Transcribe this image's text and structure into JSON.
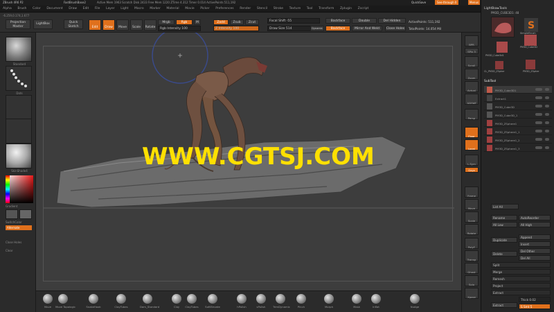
{
  "titlebar": {
    "app": "ZBrush 4R6 P2",
    "doc": "FastBrushBase2",
    "stats": "Active Mem 1963  Scratch Disk 2433  Free Mem 1220  ZTime 4.312  Timer 0.014  ActivePoints 511,192",
    "quicksave": "QuickSave",
    "see_through": "See-through  0",
    "menus": "Menus",
    "script": "DefaultZScript"
  },
  "menubar": {
    "items": [
      "Alpha",
      "Brush",
      "Color",
      "Document",
      "Draw",
      "Edit",
      "File",
      "Layer",
      "Light",
      "Macro",
      "Marker",
      "Material",
      "Movie",
      "Picker",
      "Preferences",
      "Render",
      "Stencil",
      "Stroke",
      "Texture",
      "Tool",
      "Transform",
      "Zplugin",
      "Zscript"
    ]
  },
  "coords": "-6.259,0.174,1.677",
  "topbar": {
    "projection_master": "Projection Master",
    "lightbox": "LightBox",
    "quick_sketch": "Quick Sketch",
    "edit": "Edit",
    "draw": "Draw",
    "move": "Move",
    "scale": "Scale",
    "rotate": "Rotate",
    "mrgb": "Mrgb",
    "rgb": "Rgb",
    "m": "M",
    "zadd": "Zadd",
    "zsub": "Zsub",
    "zcut": "Zcut",
    "rgb_intensity": "Rgb Intensity 100",
    "z_intensity": "Z Intensity 100",
    "z_intensity_value": 1.0,
    "focal_shift": "Focal Shift -55",
    "draw_size": "Draw Size 514",
    "dynamic": "Dynamic",
    "backface": "Backface",
    "double": "Double",
    "del_hidden": "Del Hidden",
    "close_holes": "Close Holes",
    "mirror_weld": "Mirror And Weld",
    "active_points": "ActivePoints: 511,192",
    "total_points": "TotalPoints: 14.054 Mil",
    "focal_shift_value": 0.22
  },
  "leftshelf": {
    "labels": [
      "Standard",
      "Dots",
      "Alpha Off",
      "Texture Off",
      "SkinShade4"
    ],
    "gradient": "Gradient",
    "switch_color": "SwitchColor",
    "alternate": "Alternate",
    "close_holes": "Close Holes",
    "clear": "Clear"
  },
  "rightshelf": {
    "buttons": [
      "BPR",
      "SPix 3",
      "Scroll",
      "Zoom",
      "Actual",
      "AAHalf",
      "Persp",
      "Floor",
      "Local",
      "L.Sym",
      "Gxyz",
      "Frame",
      "Move",
      "Scale",
      "Rotate",
      "PolyF",
      "Transp",
      "Ghost",
      "Solo",
      "Xpose"
    ]
  },
  "tray": {
    "header": "LightBox▸Tools",
    "tool_name": "PM3D_CUBE3D1: 48",
    "tools": [
      "PM3D_Cube3d1",
      "SimpleBrush",
      "PM3D_Cube3D",
      "CL_PM3D_ZSpher",
      "PM3D_ZSpher"
    ],
    "subtool_title": "SubTool",
    "subtools": [
      "PM3D_Cube3D1",
      "Extract1",
      "PM3D_Cube3D",
      "PM3D_Cube3D_1",
      "PM3D_ZSphere1",
      "PM3D_ZSphere1_1",
      "PM3D_ZSphere1_2",
      "PM3D_ZSphere1_3"
    ],
    "list_all": "List All",
    "rename": "Rename",
    "auto_reorder": "AutoReorder",
    "all_low": "All Low",
    "all_high": "All High",
    "duplicate": "Duplicate",
    "append": "Append",
    "insert": "Insert",
    "delete": "Delete",
    "del_other": "Del Other",
    "del_all": "Del All",
    "split": "Split",
    "merge": "Merge",
    "remesh": "Remesh",
    "project": "Project",
    "extract": "Extract",
    "thick": "Thick 0.02",
    "s_smt": "S Smt 5"
  },
  "bottom": {
    "brushes": [
      "Move",
      "Move Topologic",
      "SnakeHook",
      "ClayTubes",
      "Dam_Standard",
      "Clay",
      "ClayTubes",
      "SoftElevate",
      "hPolish",
      "sPolish",
      "TrimDynamic",
      "Pinch",
      "Morph",
      "Mask",
      "Inflat",
      "Nudge"
    ]
  },
  "watermark": "WWW.CGTSJ.COM",
  "colors": {
    "accent": "#e0701c",
    "watermark": "#ffe000",
    "canvas": "#3d3d3d"
  }
}
